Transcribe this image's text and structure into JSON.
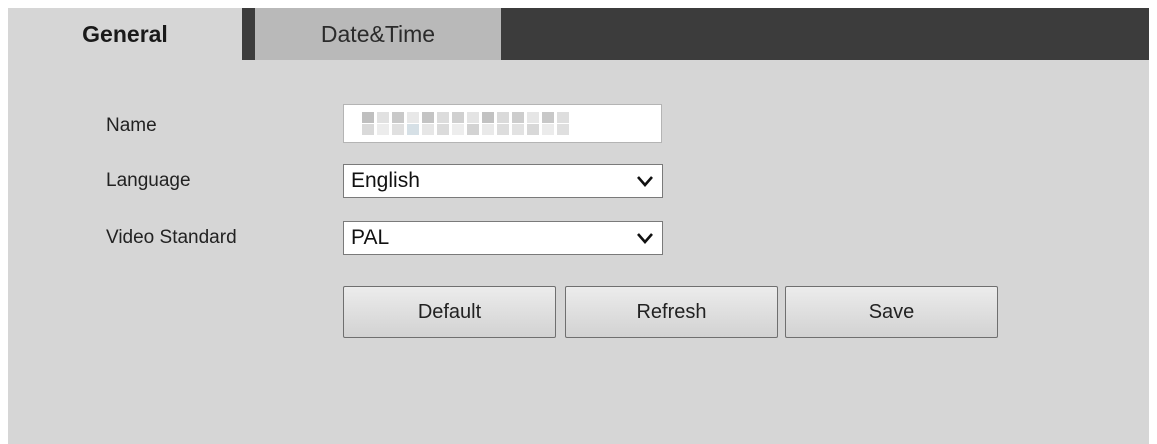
{
  "tabs": {
    "general_label": "General",
    "datetime_label": "Date&Time"
  },
  "form": {
    "name_label": "Name",
    "name_value_icon": "pixelated-redacted-text",
    "language_label": "Language",
    "language_value": "English",
    "video_standard_label": "Video Standard",
    "video_standard_value": "PAL"
  },
  "buttons": {
    "default_label": "Default",
    "refresh_label": "Refresh",
    "save_label": "Save"
  },
  "colors": {
    "panel": "#d6d6d6",
    "tabbar": "#3c3c3c",
    "active_tab": "#d6d6d6",
    "inactive_tab": "#b9b9b9"
  }
}
